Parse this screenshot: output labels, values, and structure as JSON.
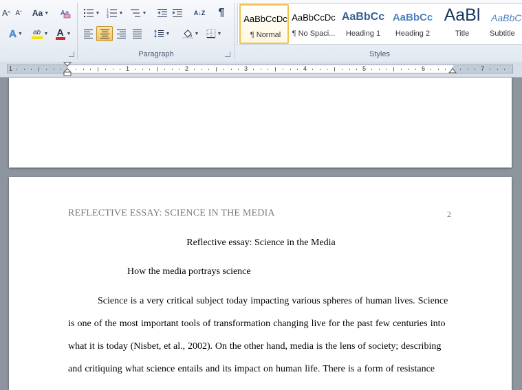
{
  "ribbon": {
    "font_group": {
      "grow_font": "A",
      "shrink_font": "A",
      "change_case": "Aa",
      "text_effects": "A",
      "highlight": "ab",
      "font_color": "A",
      "highlight_color": "#f5e200",
      "font_color_value": "#d22a2a"
    },
    "paragraph_group": {
      "label": "Paragraph",
      "pilcrow": "¶",
      "sort": "A↓Z"
    },
    "styles_group": {
      "label": "Styles",
      "items": [
        {
          "preview": "AaBbCcDc",
          "name": "¶ Normal",
          "color": "#000000"
        },
        {
          "preview": "AaBbCcDc",
          "name": "¶ No Spaci...",
          "color": "#000000"
        },
        {
          "preview": "AaBbCc",
          "name": "Heading 1",
          "color": "#365f91"
        },
        {
          "preview": "AaBbCc",
          "name": "Heading 2",
          "color": "#4f81bd"
        },
        {
          "preview": "AaBl",
          "name": "Title",
          "color": "#17365d"
        },
        {
          "preview": "AaBbCc",
          "name": "Subtitle",
          "color": "#4f81bd"
        }
      ]
    }
  },
  "ruler": {
    "numbers": [
      "1",
      "1",
      "2",
      "3",
      "4",
      "5",
      "6",
      "7"
    ]
  },
  "document": {
    "header_text": "REFLECTIVE ESSAY: SCIENCE IN THE MEDIA",
    "page_number": "2",
    "title": "Reflective essay: Science in the Media",
    "subheading": "How the media portrays science",
    "lines": [
      "Science is a very critical subject today impacting various spheres of human lives. Science",
      "is one of the most important tools of transformation changing live for the past few centuries into",
      "what it is today (Nisbet, et al., 2002). On the other hand, media is the lens of society; describing",
      "and critiquing what science entails and its impact on human life. There is a form of resistance"
    ]
  }
}
